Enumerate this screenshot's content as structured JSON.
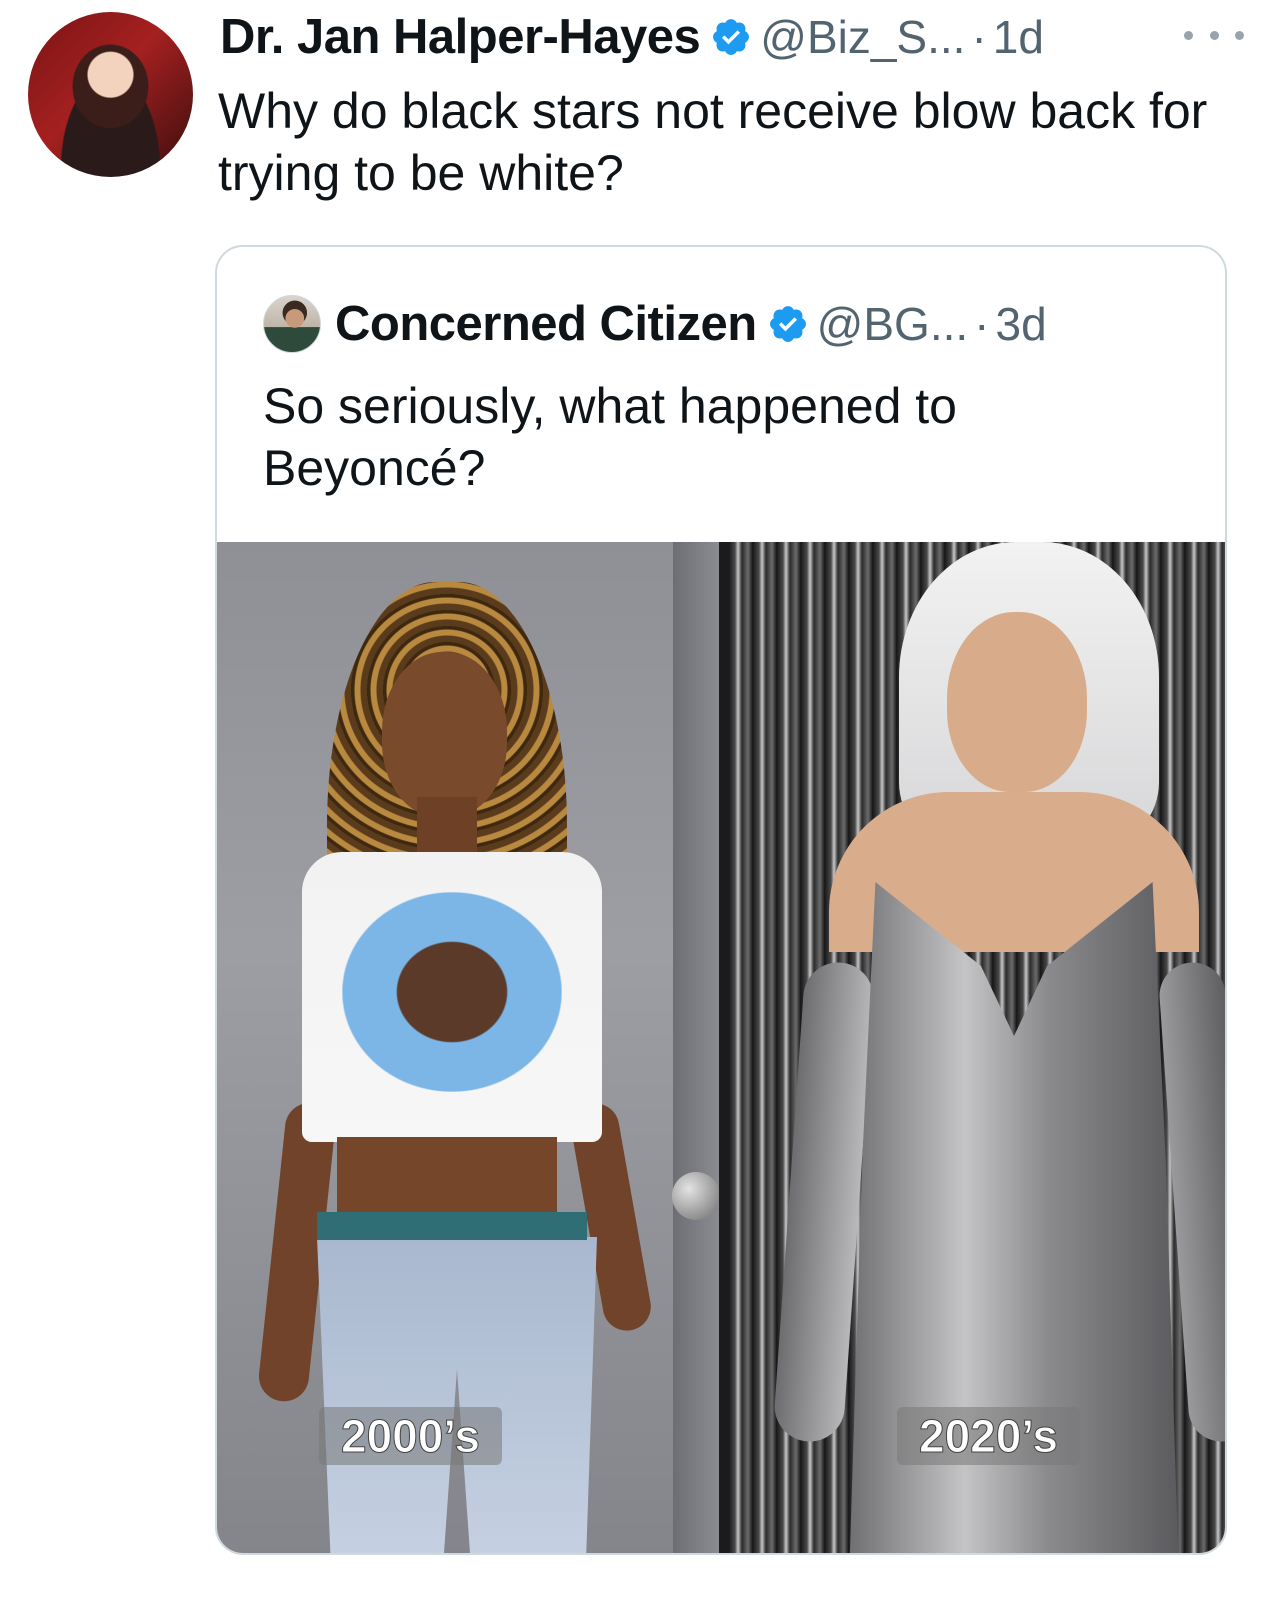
{
  "tweet": {
    "display_name": "Dr. Jan Halper-Hayes",
    "handle": "@Biz_S...",
    "separator": "·",
    "time": "1d",
    "text": "Why do black stars not receive blow back for trying to be white?",
    "verified_color": "#1d9bf0"
  },
  "quoted_tweet": {
    "display_name": "Concerned Citizen",
    "handle": "@BG...",
    "separator": "·",
    "time": "3d",
    "text": "So seriously, what happened to Beyoncé?",
    "media": {
      "left_label": "2000’s",
      "right_label": "2020’s"
    }
  },
  "colors": {
    "text_primary": "#0f1419",
    "text_secondary": "#536471",
    "border": "#cfd9de"
  },
  "icons": [
    "verified-badge-icon",
    "more-options-icon"
  ]
}
